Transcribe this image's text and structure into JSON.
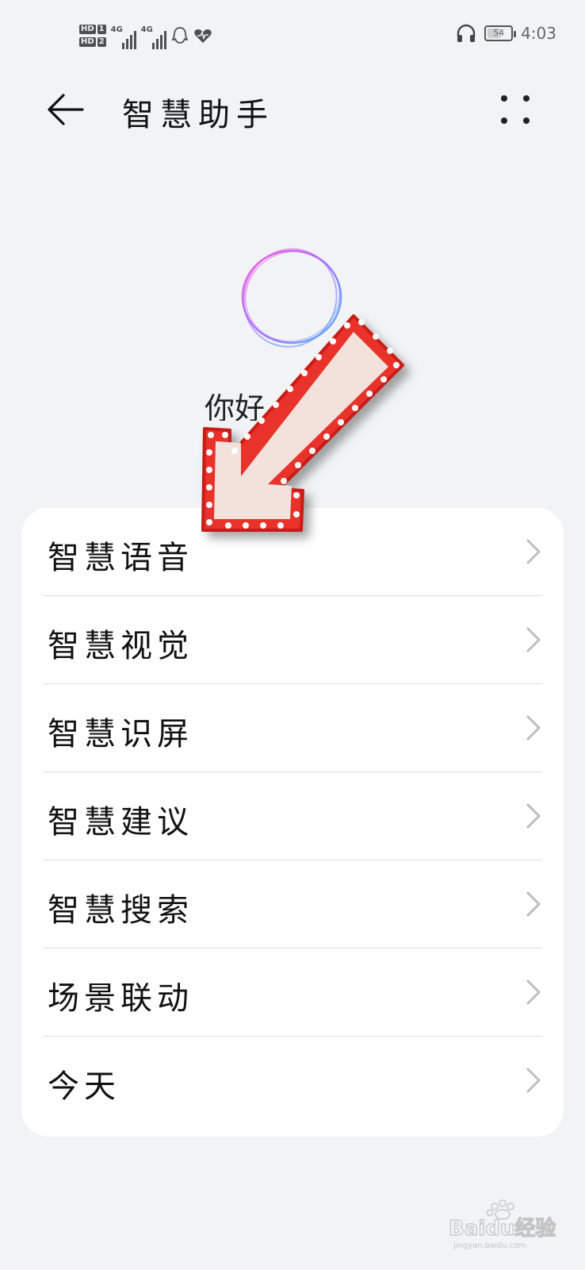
{
  "status_bar": {
    "sim1_label": "HD",
    "sim1_slot": "1",
    "sim2_label": "HD",
    "sim2_slot": "2",
    "network1": "4G",
    "network2": "4G",
    "battery_level": "54",
    "time": "4:03",
    "icons": [
      "signal-icon",
      "qq-icon",
      "health-icon",
      "headphones-icon",
      "battery-icon"
    ]
  },
  "header": {
    "title": "智慧助手",
    "back_icon": "back-arrow-icon",
    "more_icon": "more-dots-icon"
  },
  "hero": {
    "greeting": "你好"
  },
  "menu": {
    "items": [
      {
        "label": "智慧语音"
      },
      {
        "label": "智慧视觉"
      },
      {
        "label": "智慧识屏"
      },
      {
        "label": "智慧建议"
      },
      {
        "label": "智慧搜索"
      },
      {
        "label": "场景联动"
      },
      {
        "label": "今天"
      }
    ]
  },
  "overlay": {
    "icon": "pointer-arrow-icon",
    "color": "#e8322a"
  },
  "watermark": {
    "text": "Baidu经验",
    "subtext": "jingyan.baidu.com"
  }
}
